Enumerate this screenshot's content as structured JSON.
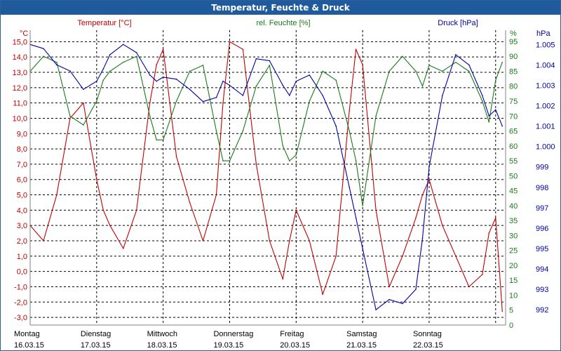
{
  "window": {
    "title": "Temperatur, Feuchte & Druck"
  },
  "colors": {
    "temperature": "#c00000",
    "humidity": "#1a7a1a",
    "pressure": "#0000a0",
    "grid": "#000000",
    "title_bg": "#1e5a9c",
    "title_fg": "#ffffff",
    "text": "#000000"
  },
  "chart_data": {
    "type": "line",
    "title": "Temperatur, Feuchte & Druck",
    "grid": true,
    "axes": {
      "temperature": {
        "unit": "°C",
        "label": "Temperatur [°C]",
        "side": "left",
        "range": [
          -3.5,
          15.75
        ],
        "ticks": [
          "15,0",
          "14,0",
          "13,0",
          "12,0",
          "11,0",
          "10,0",
          "9,0",
          "8,0",
          "7,0",
          "6,0",
          "5,0",
          "4,0",
          "3,0",
          "2,0",
          "1,0",
          "0,0",
          "-1,0",
          "-2,0",
          "-3,0"
        ],
        "tick_values": [
          15,
          14,
          13,
          12,
          11,
          10,
          9,
          8,
          7,
          6,
          5,
          4,
          3,
          2,
          1,
          0,
          -1,
          -2,
          -3
        ]
      },
      "humidity": {
        "unit": "%",
        "label": "rel. Feuchte [%]",
        "side": "right-inner",
        "range": [
          0,
          98.75
        ],
        "ticks": [
          "95",
          "90",
          "85",
          "80",
          "75",
          "70",
          "65",
          "60",
          "55",
          "50",
          "45",
          "40",
          "35",
          "30",
          "25",
          "20",
          "15",
          "10",
          "5",
          "0"
        ],
        "tick_values": [
          95,
          90,
          85,
          80,
          75,
          70,
          65,
          60,
          55,
          50,
          45,
          40,
          35,
          30,
          25,
          20,
          15,
          10,
          5,
          0
        ]
      },
      "pressure": {
        "unit": "hPa",
        "label": "Druck [hPa]",
        "side": "right-outer",
        "range": [
          991.25,
          1005.7
        ],
        "ticks": [
          "1.005",
          "1.004",
          "1.003",
          "1.002",
          "1.001",
          "1.000",
          "999",
          "998",
          "997",
          "996",
          "995",
          "994",
          "993",
          "992"
        ],
        "tick_values": [
          1005,
          1004,
          1003,
          1002,
          1001,
          1000,
          999,
          998,
          997,
          996,
          995,
          994,
          993,
          992
        ]
      }
    },
    "x_axis": {
      "unit": "days",
      "range": [
        0,
        7.15
      ],
      "days": [
        {
          "weekday": "Montag",
          "date": "16.03.15"
        },
        {
          "weekday": "Dienstag",
          "date": "17.03.15"
        },
        {
          "weekday": "Mittwoch",
          "date": "18.03.15"
        },
        {
          "weekday": "Donnerstag",
          "date": "19.03.15"
        },
        {
          "weekday": "Freitag",
          "date": "20.03.15"
        },
        {
          "weekday": "Samstag",
          "date": "21.03.15"
        },
        {
          "weekday": "Sonntag",
          "date": "22.03.15"
        }
      ]
    },
    "series": [
      {
        "name": "Temperatur [°C]",
        "axis": "temperature",
        "x": [
          0,
          0.2,
          0.4,
          0.6,
          0.8,
          1.0,
          1.1,
          1.2,
          1.4,
          1.6,
          1.8,
          1.9,
          2.0,
          2.2,
          2.4,
          2.6,
          2.8,
          2.9,
          3.0,
          3.2,
          3.4,
          3.6,
          3.8,
          3.9,
          4.0,
          4.2,
          4.4,
          4.6,
          4.8,
          4.9,
          5.0,
          5.2,
          5.4,
          5.6,
          5.8,
          5.9,
          6.0,
          6.2,
          6.4,
          6.6,
          6.8,
          6.9,
          7.0,
          7.1
        ],
        "values": [
          3.0,
          2.0,
          5.0,
          10.0,
          11.0,
          6.0,
          4.0,
          3.0,
          1.5,
          4.0,
          11.0,
          13.5,
          14.5,
          7.5,
          4.5,
          2.0,
          5.0,
          11.0,
          15.0,
          14.5,
          7.0,
          2.0,
          -0.5,
          2.0,
          4.0,
          2.0,
          -1.5,
          1.0,
          10.5,
          14.5,
          13.5,
          4.0,
          -1.0,
          1.0,
          3.5,
          5.0,
          6.0,
          3.0,
          1.0,
          -1.0,
          -0.2,
          2.5,
          3.5,
          -2.6
        ],
        "color": "#c00000"
      },
      {
        "name": "rel. Feuchte [%]",
        "axis": "humidity",
        "x": [
          0,
          0.2,
          0.4,
          0.6,
          0.8,
          1.0,
          1.1,
          1.2,
          1.4,
          1.6,
          1.8,
          1.9,
          2.0,
          2.2,
          2.4,
          2.6,
          2.8,
          2.9,
          3.0,
          3.2,
          3.4,
          3.6,
          3.8,
          3.9,
          4.0,
          4.2,
          4.4,
          4.6,
          4.8,
          4.9,
          5.0,
          5.2,
          5.4,
          5.6,
          5.8,
          5.9,
          6.0,
          6.2,
          6.4,
          6.6,
          6.8,
          6.9,
          7.0,
          7.1
        ],
        "values": [
          85.0,
          90.0,
          88.0,
          70.0,
          67.0,
          75.0,
          82.0,
          85.0,
          88.0,
          90.0,
          70.0,
          62.0,
          62.0,
          75.0,
          85.0,
          87.0,
          65.0,
          55.0,
          55.0,
          65.0,
          80.0,
          87.0,
          60.0,
          55.0,
          57.0,
          75.0,
          85.0,
          82.0,
          65.0,
          55.0,
          40.0,
          70.0,
          85.0,
          90.0,
          85.0,
          80.0,
          87.0,
          85.0,
          88.0,
          85.0,
          75.0,
          68.0,
          82.0,
          88.0
        ],
        "color": "#1a7a1a"
      },
      {
        "name": "Druck [hPa]",
        "axis": "pressure",
        "x": [
          0,
          0.2,
          0.4,
          0.6,
          0.8,
          1.0,
          1.1,
          1.2,
          1.4,
          1.6,
          1.8,
          1.9,
          2.0,
          2.2,
          2.4,
          2.6,
          2.8,
          2.9,
          3.0,
          3.2,
          3.4,
          3.6,
          3.8,
          3.9,
          4.0,
          4.2,
          4.4,
          4.6,
          4.8,
          4.9,
          5.0,
          5.2,
          5.4,
          5.6,
          5.8,
          5.9,
          6.0,
          6.2,
          6.4,
          6.6,
          6.8,
          6.9,
          7.0,
          7.1
        ],
        "values": [
          1005.0,
          1004.8,
          1004.0,
          1003.7,
          1002.8,
          1003.2,
          1003.8,
          1004.5,
          1005.0,
          1004.6,
          1003.5,
          1003.2,
          1003.4,
          1003.3,
          1002.8,
          1002.2,
          1002.4,
          1003.2,
          1003.0,
          1002.5,
          1004.3,
          1004.2,
          1003.0,
          1002.5,
          1003.2,
          1003.5,
          1002.5,
          1001.0,
          998.0,
          996.5,
          995.0,
          992.0,
          992.5,
          992.3,
          993.0,
          995.5,
          999.0,
          1002.5,
          1004.5,
          1004.0,
          1002.5,
          1001.5,
          1001.8,
          1001.0
        ],
        "color": "#0000a0"
      }
    ]
  }
}
